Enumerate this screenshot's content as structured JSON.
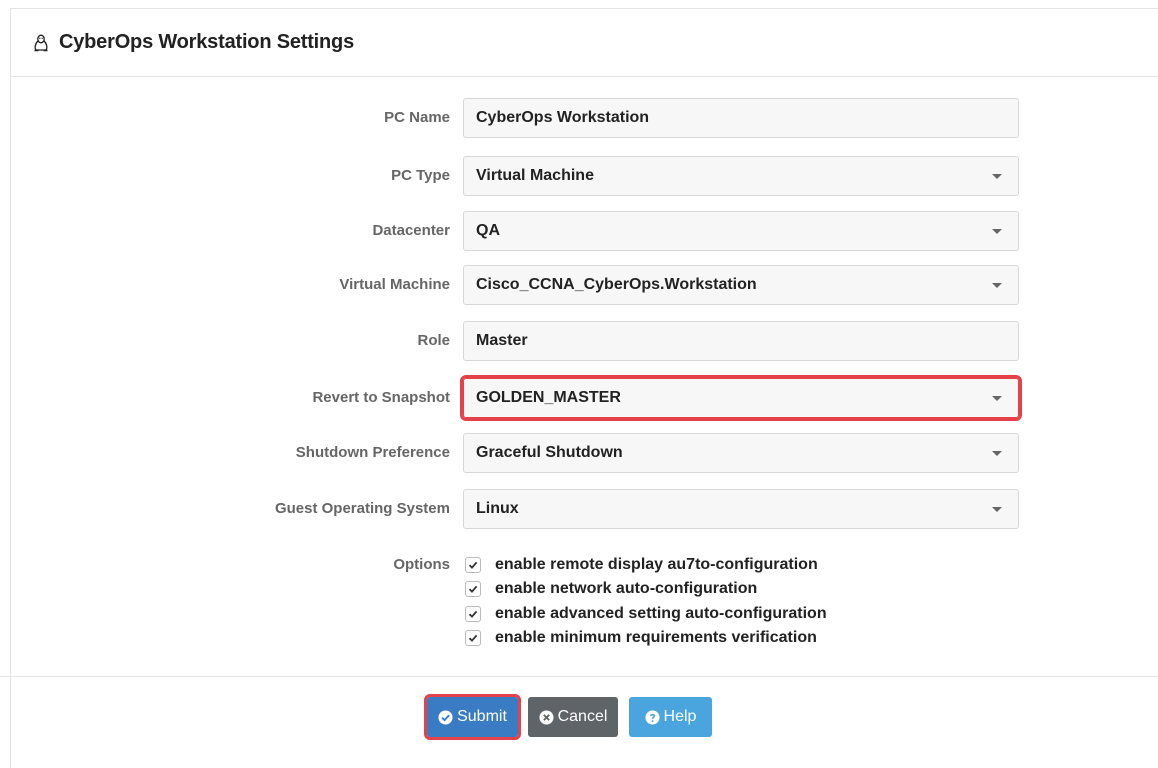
{
  "header": {
    "title": "CyberOps Workstation Settings",
    "icon": "linux-penguin-icon"
  },
  "fields": {
    "pc_name": {
      "label": "PC Name",
      "value": "CyberOps Workstation"
    },
    "pc_type": {
      "label": "PC Type",
      "value": "Virtual Machine"
    },
    "datacenter": {
      "label": "Datacenter",
      "value": "QA"
    },
    "virtual_machine": {
      "label": "Virtual Machine",
      "value": "Cisco_CCNA_CyberOps.Workstation"
    },
    "role": {
      "label": "Role",
      "value": "Master"
    },
    "revert_snapshot": {
      "label": "Revert to Snapshot",
      "value": "GOLDEN_MASTER"
    },
    "shutdown_pref": {
      "label": "Shutdown Preference",
      "value": "Graceful Shutdown"
    },
    "guest_os": {
      "label": "Guest Operating System",
      "value": "Linux"
    }
  },
  "options": {
    "label": "Options",
    "items": [
      {
        "text": "enable remote display au7to-configuration",
        "checked": true
      },
      {
        "text": "enable network auto-configuration",
        "checked": true
      },
      {
        "text": "enable advanced setting auto-configuration",
        "checked": true
      },
      {
        "text": "enable minimum requirements verification",
        "checked": true
      }
    ]
  },
  "buttons": {
    "submit": "Submit",
    "cancel": "Cancel",
    "help": "Help"
  },
  "colors": {
    "primary": "#3a7cc4",
    "secondary": "#5f6469",
    "info": "#4aa5de",
    "highlight": "#e5414a"
  }
}
